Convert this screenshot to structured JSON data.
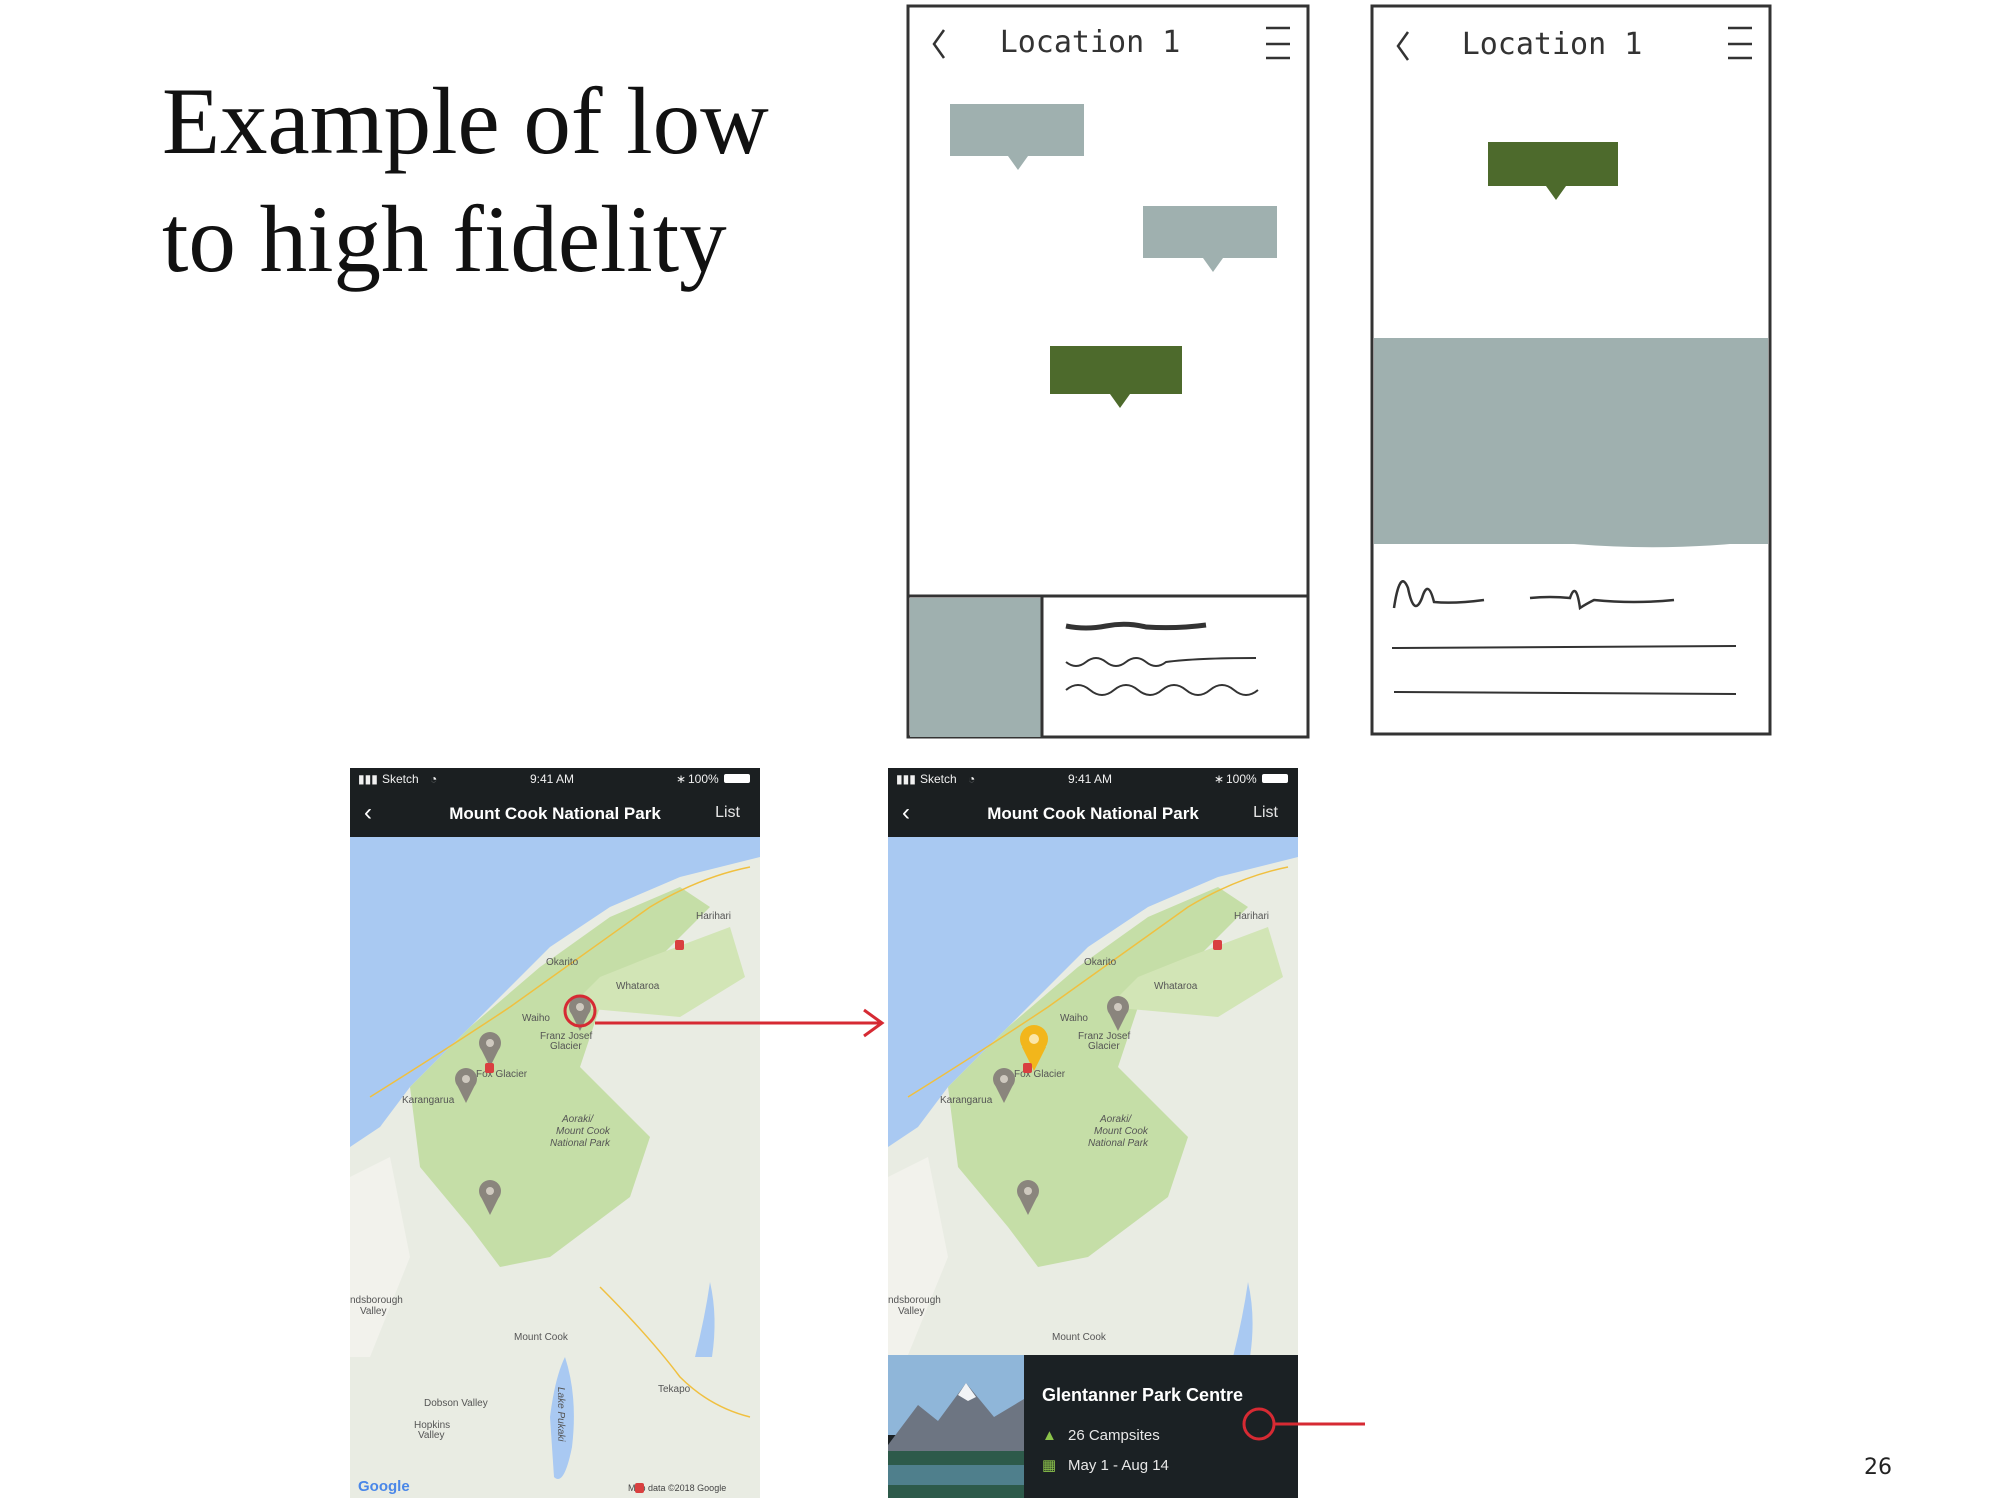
{
  "slide": {
    "title_line1": "Example of low",
    "title_line2": "to high fidelity",
    "page_number": "26"
  },
  "sketches": {
    "screen_title": "Location 1"
  },
  "mockups": {
    "status": {
      "carrier": "Sketch",
      "time": "9:41 AM",
      "battery": "100%"
    },
    "nav": {
      "back_icon": "chevron-left-icon",
      "title": "Mount Cook National Park",
      "list_label": "List"
    },
    "map_labels": {
      "harihari": "Harihari",
      "okarito": "Okarito",
      "whataroa": "Whataroa",
      "waiho": "Waiho",
      "franz_josef_1": "Franz Josef",
      "franz_josef_2": "Glacier",
      "fox_glacier": "Fox Glacier",
      "karangarua": "Karangarua",
      "park_1": "Aoraki/",
      "park_2": "Mount Cook",
      "park_3": "National Park",
      "landsborough_1": "ndsborough",
      "landsborough_2": "Valley",
      "mount_cook": "Mount Cook",
      "lake_pukaki": "Lake Pukaki",
      "tekapo": "Tekapo",
      "dobson": "Dobson Valley",
      "hopkins_1": "Hopkins",
      "hopkins_2": "Valley",
      "google": "Google",
      "map_data": "Map data ©2018 Google"
    },
    "card": {
      "title": "Glentanner Park Centre",
      "campsites": "26 Campsites",
      "dates": "May 1 - Aug 14",
      "campsite_icon": "tent-icon",
      "calendar_icon": "calendar-icon"
    }
  },
  "colors": {
    "sketch_grey": "#9fb0af",
    "sketch_green": "#4d6a2c",
    "nav_dark": "#1b1f21",
    "water": "#a9c9f2",
    "park_green": "#c5dea7",
    "pin_grey": "#8a857d",
    "pin_selected": "#f2b61b",
    "annotation_red": "#d62a33"
  }
}
